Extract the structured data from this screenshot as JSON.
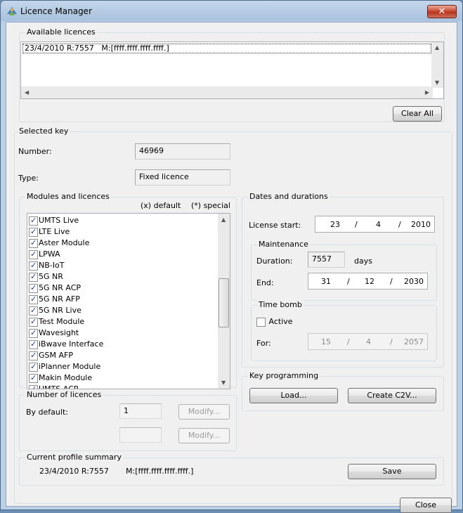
{
  "window": {
    "title": "Licence Manager",
    "close_glyph": "✕"
  },
  "available": {
    "legend": "Available licences",
    "items": [
      "23/4/2010 R:7557   M:[ffff.ffff.ffff.ffff.]"
    ],
    "clear_all": "Clear All"
  },
  "selected_key": {
    "legend": "Selected key",
    "number_label": "Number:",
    "number_value": "46969",
    "type_label": "Type:",
    "type_value": "Fixed licence"
  },
  "modules": {
    "legend": "Modules and licences",
    "default_hint": "(x) default",
    "special_hint": "(*) special",
    "items": [
      {
        "label": "UMTS Live",
        "checked": true
      },
      {
        "label": "LTE Live",
        "checked": true
      },
      {
        "label": "Aster Module",
        "checked": true
      },
      {
        "label": "LPWA",
        "checked": true
      },
      {
        "label": "NB-IoT",
        "checked": true
      },
      {
        "label": "5G NR",
        "checked": true
      },
      {
        "label": "5G NR ACP",
        "checked": true
      },
      {
        "label": "5G NR AFP",
        "checked": true
      },
      {
        "label": "5G NR Live",
        "checked": true
      },
      {
        "label": "Test Module",
        "checked": true
      },
      {
        "label": "Wavesight",
        "checked": true
      },
      {
        "label": "iBwave Interface",
        "checked": true
      },
      {
        "label": "GSM AFP",
        "checked": true
      },
      {
        "label": "iPlanner Module",
        "checked": true
      },
      {
        "label": "Makin Module",
        "checked": true
      },
      {
        "label": "UMTS ACP",
        "checked": true
      }
    ]
  },
  "num_licences": {
    "legend": "Number of licences",
    "by_default_label": "By default:",
    "by_default_value": "1",
    "second_value": "",
    "modify_label": "Modify..."
  },
  "dates": {
    "legend": "Dates and durations",
    "license_start_label": "License start:",
    "start": {
      "day": "23",
      "month": "4",
      "year": "2010"
    },
    "separator": "/",
    "maintenance": {
      "legend": "Maintenance",
      "duration_label": "Duration:",
      "duration_value": "7557",
      "duration_unit": "days",
      "end_label": "End:",
      "end": {
        "day": "31",
        "month": "12",
        "year": "2030"
      }
    },
    "timebomb": {
      "legend": "Time bomb",
      "active_label": "Active",
      "active": false,
      "for_label": "For:",
      "for": {
        "day": "15",
        "month": "4",
        "year": "2057"
      }
    }
  },
  "key_programming": {
    "legend": "Key programming",
    "load": "Load...",
    "create_c2v": "Create C2V..."
  },
  "profile_summary": {
    "legend": "Current profile summary",
    "date_rev": "23/4/2010 R:7557",
    "mask": "M:[ffff.ffff.ffff.ffff.]",
    "save": "Save"
  },
  "footer": {
    "close": "Close"
  },
  "colors": {
    "accent": "#3399ff",
    "close_red": "#c7462e"
  }
}
